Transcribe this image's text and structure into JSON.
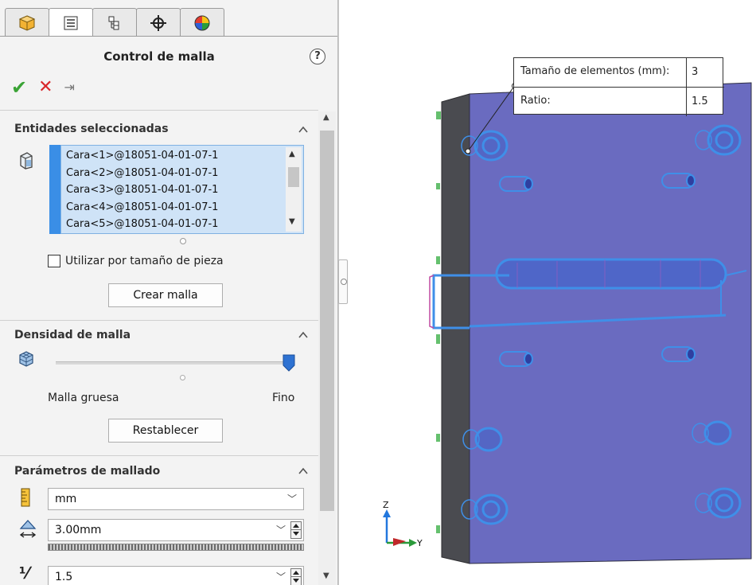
{
  "panel": {
    "tabs": [
      {
        "name": "feature-manager",
        "icon": "part-cube-icon"
      },
      {
        "name": "property-manager",
        "icon": "property-list-icon"
      },
      {
        "name": "configuration-manager",
        "icon": "configuration-icon"
      },
      {
        "name": "dimxpert-manager",
        "icon": "crosshair-icon"
      },
      {
        "name": "display-manager",
        "icon": "color-wheel-icon"
      }
    ],
    "title": "Control de malla",
    "help_label": "?",
    "actions": {
      "ok": "✔",
      "cancel": "✕",
      "pin": "⇥"
    }
  },
  "selected_entities": {
    "title": "Entidades seleccionadas",
    "items": [
      "Cara<1>@18051-04-01-07-1",
      "Cara<2>@18051-04-01-07-1",
      "Cara<3>@18051-04-01-07-1",
      "Cara<4>@18051-04-01-07-1",
      "Cara<5>@18051-04-01-07-1"
    ],
    "use_part_size_label": "Utilizar por tamaño de pieza",
    "use_part_size_checked": false,
    "create_mesh_button": "Crear malla"
  },
  "mesh_density": {
    "title": "Densidad de malla",
    "coarse_label": "Malla gruesa",
    "fine_label": "Fino",
    "slider_value": 1.0,
    "reset_button": "Restablecer"
  },
  "mesh_parameters": {
    "title": "Parámetros de mallado",
    "unit": "mm",
    "element_size": "3.00mm",
    "ratio": "1.5",
    "ratio_icon_text": "⅟"
  },
  "viewport": {
    "callout": {
      "element_size_label": "Tamaño de elementos (mm):",
      "element_size_value": "3",
      "ratio_label": "Ratio:",
      "ratio_value": "1.5"
    },
    "triad": {
      "z": "Z",
      "y": "Y"
    },
    "colors": {
      "plate_face": "#6a6bc0",
      "plate_side": "#4a4b50",
      "mesh_control": "#3f8fe8"
    }
  }
}
